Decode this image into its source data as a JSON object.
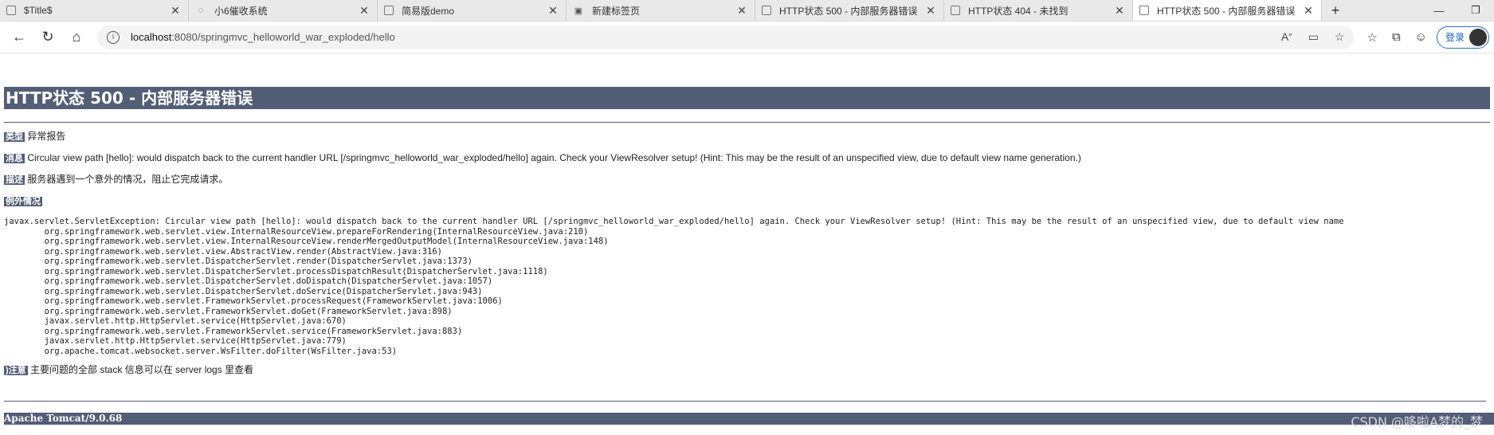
{
  "tabs": [
    {
      "title": "$Title$",
      "icon": "page-icon"
    },
    {
      "title": "小6催收系统",
      "icon": "loading-icon"
    },
    {
      "title": "简易版demo",
      "icon": "page-icon"
    },
    {
      "title": "新建标签页",
      "icon": "newtab-icon"
    },
    {
      "title": "HTTP状态 500 - 内部服务器错误",
      "icon": "page-icon"
    },
    {
      "title": "HTTP状态 404 - 未找到",
      "icon": "page-icon"
    },
    {
      "title": "HTTP状态 500 - 内部服务器错误",
      "icon": "page-icon",
      "active": true
    }
  ],
  "address": {
    "host": "localhost",
    "rest": ":8080/springmvc_helloworld_war_exploded/hello"
  },
  "login_label": "登录",
  "page": {
    "heading": "HTTP状态 500 - 内部服务器错误",
    "type_label": "类型",
    "type_value": "异常报告",
    "message_label": "消息",
    "message_value": "Circular view path [hello]: would dispatch back to the current handler URL [/springmvc_helloworld_war_exploded/hello] again. Check your ViewResolver setup! (Hint: This may be the result of an unspecified view, due to default view name generation.)",
    "desc_label": "描述",
    "desc_value": "服务器遇到一个意外的情况，阻止它完成请求。",
    "exception_label": "例外情况",
    "stack_trace": "javax.servlet.ServletException: Circular view path [hello]: would dispatch back to the current handler URL [/springmvc_helloworld_war_exploded/hello] again. Check your ViewResolver setup! (Hint: This may be the result of an unspecified view, due to default view name\n\torg.springframework.web.servlet.view.InternalResourceView.prepareForRendering(InternalResourceView.java:210)\n\torg.springframework.web.servlet.view.InternalResourceView.renderMergedOutputModel(InternalResourceView.java:148)\n\torg.springframework.web.servlet.view.AbstractView.render(AbstractView.java:316)\n\torg.springframework.web.servlet.DispatcherServlet.render(DispatcherServlet.java:1373)\n\torg.springframework.web.servlet.DispatcherServlet.processDispatchResult(DispatcherServlet.java:1118)\n\torg.springframework.web.servlet.DispatcherServlet.doDispatch(DispatcherServlet.java:1057)\n\torg.springframework.web.servlet.DispatcherServlet.doService(DispatcherServlet.java:943)\n\torg.springframework.web.servlet.FrameworkServlet.processRequest(FrameworkServlet.java:1006)\n\torg.springframework.web.servlet.FrameworkServlet.doGet(FrameworkServlet.java:898)\n\tjavax.servlet.http.HttpServlet.service(HttpServlet.java:670)\n\torg.springframework.web.servlet.FrameworkServlet.service(FrameworkServlet.java:883)\n\tjavax.servlet.http.HttpServlet.service(HttpServlet.java:779)\n\torg.apache.tomcat.websocket.server.WsFilter.doFilter(WsFilter.java:53)",
    "note_label": ")注意",
    "note_value": "主要问题的全部 stack 信息可以在 server logs 里查看",
    "footer": "Apache Tomcat/9.0.68"
  },
  "watermark": "CSDN @哆啦A梦的_梦"
}
